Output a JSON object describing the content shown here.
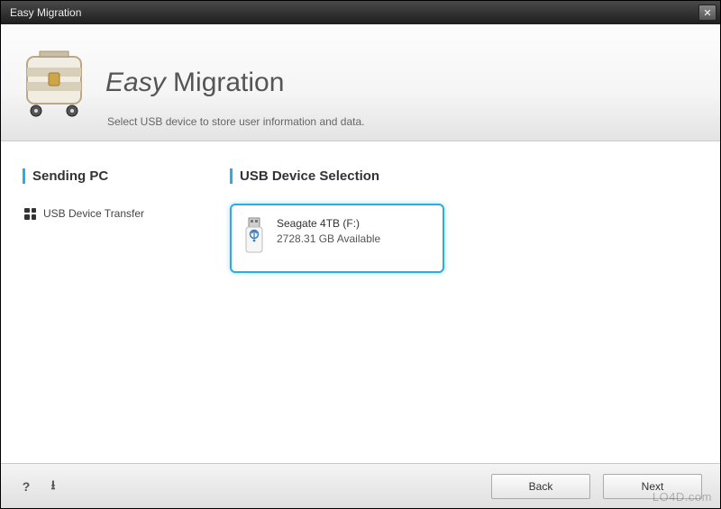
{
  "window": {
    "title": "Easy Migration"
  },
  "header": {
    "title_light": "Easy",
    "title_bold": "Migration",
    "subtitle": "Select USB device to store user information and data."
  },
  "sidebar": {
    "title": "Sending PC",
    "items": [
      {
        "label": "USB Device Transfer",
        "icon": "usb-grid-icon"
      }
    ]
  },
  "main": {
    "title": "USB Device Selection",
    "devices": [
      {
        "name": "Seagate 4TB (F:)",
        "available": "2728.31 GB Available",
        "icon": "usb-flash-icon",
        "selected": true
      }
    ]
  },
  "footer": {
    "help_label": "?",
    "download_label": "⭳",
    "back_label": "Back",
    "next_label": "Next"
  },
  "watermark": "LO4D.com",
  "colors": {
    "accent": "#28aee4"
  }
}
